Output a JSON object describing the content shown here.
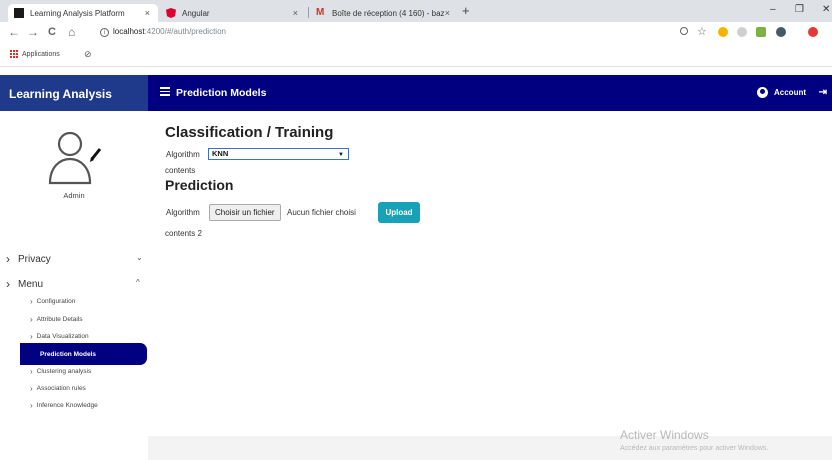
{
  "browser": {
    "tabs": [
      {
        "label": "Learning Analysis Platform",
        "close": "×"
      },
      {
        "label": "Angular",
        "close": "×"
      },
      {
        "label": "Boîte de réception (4 160) - bazz",
        "close": "×"
      }
    ],
    "new_tab": "+",
    "window_controls": {
      "minimize": "–",
      "restore": "❐",
      "close": "✕"
    },
    "nav": {
      "back": "←",
      "forward": "→",
      "reload": "C",
      "home": "⌂"
    },
    "address": {
      "info": "i",
      "host": "localhost",
      "path": ":4200/#/auth/prediction"
    },
    "bookmarks": {
      "apps_label": "Applications"
    }
  },
  "app": {
    "brand": "Learning Analysis",
    "header_title": "Prediction Models",
    "account_label": "Account"
  },
  "sidebar": {
    "user_label": "Admin",
    "sections": [
      {
        "label": "Privacy",
        "caret": "⌄"
      },
      {
        "label": "Menu",
        "caret": "^"
      }
    ],
    "items": [
      {
        "label": "Configuration"
      },
      {
        "label": "Attribute Details"
      },
      {
        "label": "Data Visualization"
      },
      {
        "label": "Prediction Models"
      },
      {
        "label": "Clustering analysis"
      },
      {
        "label": "Association rules"
      },
      {
        "label": "Inference Knowledge"
      }
    ]
  },
  "main": {
    "training_title": "Classification / Training",
    "algorithm_label": "Algorithm",
    "algorithm_selected": "KNN",
    "contents_label": "contents",
    "prediction_title": "Prediction",
    "prediction_algorithm_label": "Algorithm",
    "file_button": "Choisir un fichier",
    "file_none": "Aucun fichier choisi",
    "upload_button": "Upload",
    "contents2_label": "contents 2"
  },
  "watermark": {
    "title": "Activer Windows",
    "subtitle": "Accédez aux paramètres pour activer Windows."
  },
  "colors": {
    "header_navy": "#000080",
    "sidebar_head": "#1f3a8a",
    "active_item": "#000080",
    "upload": "#17a2b8"
  }
}
